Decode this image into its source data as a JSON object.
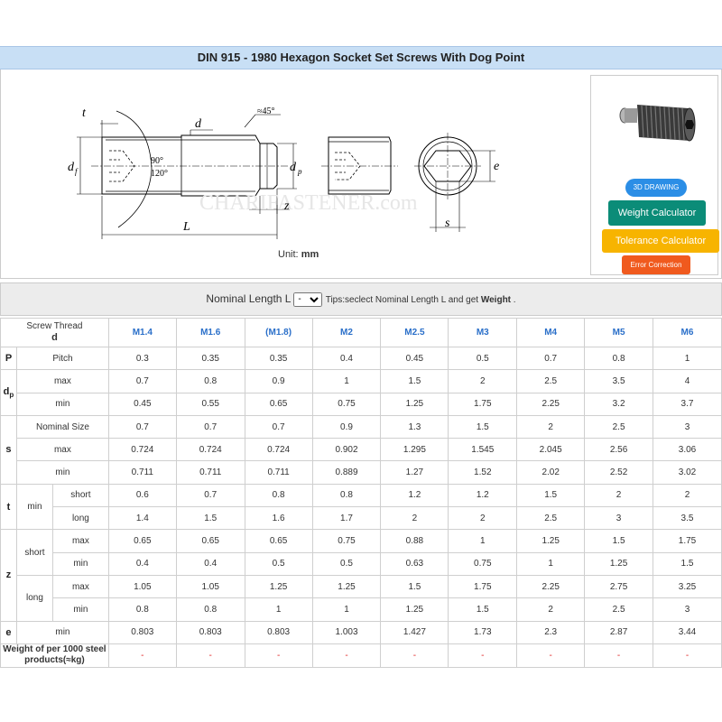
{
  "title": "DIN 915 - 1980 Hexagon Socket Set Screws With Dog Point",
  "figure": {
    "unit_prefix": "Unit: ",
    "unit_value": "mm",
    "labels": {
      "t": "t",
      "d": "d",
      "df": "d",
      "df_sub": "f",
      "angle": "≈45°",
      "deg90": "90°",
      "deg120": "120°",
      "dp": "d",
      "dp_sub": "p",
      "z": "z",
      "L": "L",
      "e": "e",
      "s": "s"
    },
    "watermark": "CHARIFASTENER.com"
  },
  "side_panel": {
    "btn_3d": "3D DRAWING",
    "btn_weight": "Weight Calculator",
    "btn_tolerance": "Tolerance Calculator",
    "btn_error": "Error Correction"
  },
  "selector": {
    "label": "Nominal Length L",
    "selected": "-",
    "options": [
      "-"
    ],
    "tips_prefix": "Tips:seclect Nominal Length L and get ",
    "tips_bold": "Weight",
    "tips_suffix": " ."
  },
  "table": {
    "header_label": "Screw Thread",
    "header_symbol": "d",
    "sizes": [
      "M1.4",
      "M1.6",
      "(M1.8)",
      "M2",
      "M2.5",
      "M3",
      "M4",
      "M5",
      "M6"
    ],
    "P": {
      "sym": "P",
      "label": "Pitch",
      "values": [
        "0.3",
        "0.35",
        "0.35",
        "0.4",
        "0.45",
        "0.5",
        "0.7",
        "0.8",
        "1"
      ]
    },
    "dp": {
      "sym": "d",
      "sub": "p",
      "max": {
        "label": "max",
        "values": [
          "0.7",
          "0.8",
          "0.9",
          "1",
          "1.5",
          "2",
          "2.5",
          "3.5",
          "4"
        ]
      },
      "min": {
        "label": "min",
        "values": [
          "0.45",
          "0.55",
          "0.65",
          "0.75",
          "1.25",
          "1.75",
          "2.25",
          "3.2",
          "3.7"
        ]
      }
    },
    "s": {
      "sym": "s",
      "nom": {
        "label": "Nominal Size",
        "values": [
          "0.7",
          "0.7",
          "0.7",
          "0.9",
          "1.3",
          "1.5",
          "2",
          "2.5",
          "3"
        ]
      },
      "max": {
        "label": "max",
        "values": [
          "0.724",
          "0.724",
          "0.724",
          "0.902",
          "1.295",
          "1.545",
          "2.045",
          "2.56",
          "3.06"
        ]
      },
      "min": {
        "label": "min",
        "values": [
          "0.711",
          "0.711",
          "0.711",
          "0.889",
          "1.27",
          "1.52",
          "2.02",
          "2.52",
          "3.02"
        ]
      }
    },
    "t": {
      "sym": "t",
      "label": "min",
      "short": {
        "label": "short",
        "values": [
          "0.6",
          "0.7",
          "0.8",
          "0.8",
          "1.2",
          "1.2",
          "1.5",
          "2",
          "2"
        ]
      },
      "long": {
        "label": "long",
        "values": [
          "1.4",
          "1.5",
          "1.6",
          "1.7",
          "2",
          "2",
          "2.5",
          "3",
          "3.5"
        ]
      }
    },
    "z": {
      "sym": "z",
      "short": {
        "label": "short",
        "max": {
          "label": "max",
          "values": [
            "0.65",
            "0.65",
            "0.65",
            "0.75",
            "0.88",
            "1",
            "1.25",
            "1.5",
            "1.75"
          ]
        },
        "min": {
          "label": "min",
          "values": [
            "0.4",
            "0.4",
            "0.5",
            "0.5",
            "0.63",
            "0.75",
            "1",
            "1.25",
            "1.5"
          ]
        }
      },
      "long": {
        "label": "long",
        "max": {
          "label": "max",
          "values": [
            "1.05",
            "1.05",
            "1.25",
            "1.25",
            "1.5",
            "1.75",
            "2.25",
            "2.75",
            "3.25"
          ]
        },
        "min": {
          "label": "min",
          "values": [
            "0.8",
            "0.8",
            "1",
            "1",
            "1.25",
            "1.5",
            "2",
            "2.5",
            "3"
          ]
        }
      }
    },
    "e": {
      "sym": "e",
      "label": "min",
      "values": [
        "0.803",
        "0.803",
        "0.803",
        "1.003",
        "1.427",
        "1.73",
        "2.3",
        "2.87",
        "3.44"
      ]
    },
    "weight": {
      "label": "Weight of per 1000 steel products(≈kg)",
      "values": [
        "-",
        "-",
        "-",
        "-",
        "-",
        "-",
        "-",
        "-",
        "-"
      ]
    }
  },
  "colors": {
    "title_bg": "#c8dff5",
    "size_blue": "#2a6fc9",
    "dash_red": "#e02020",
    "btn_3d": "#2b8ee6",
    "btn_weight": "#0b8c78",
    "btn_tolerance": "#f7b400",
    "btn_error": "#f05a1e"
  }
}
